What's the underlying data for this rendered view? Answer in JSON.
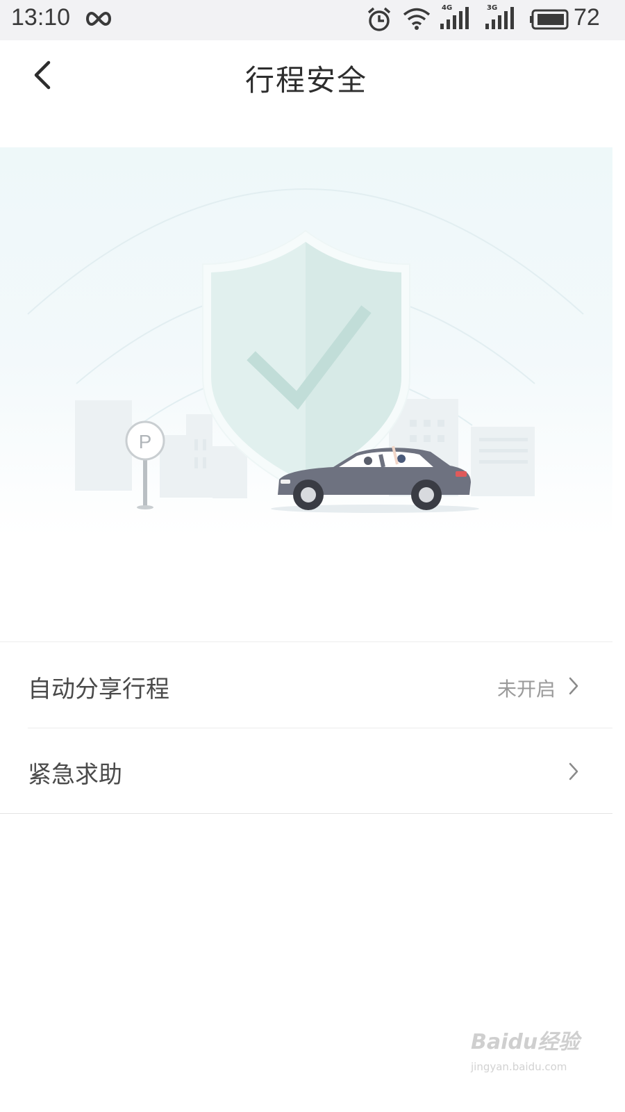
{
  "status_bar": {
    "time": "13:10",
    "battery_percent": "72",
    "network1_label": "4G",
    "network2_label": "3G",
    "icons": [
      "infinity-icon",
      "alarm-icon",
      "wifi-icon",
      "signal-4g-icon",
      "signal-3g-icon",
      "battery-icon"
    ]
  },
  "header": {
    "title": "行程安全",
    "back_icon": "chevron-left-icon"
  },
  "hero": {
    "illustration": "shield-check-car-illustration",
    "parking_sign_letter": "P"
  },
  "settings": [
    {
      "label": "自动分享行程",
      "value": "未开启",
      "icon": "chevron-right-icon"
    },
    {
      "label": "紧急求助",
      "value": "",
      "icon": "chevron-right-icon"
    }
  ],
  "watermark": {
    "text": "Baidu经验",
    "sub": "jingyan.baidu.com"
  },
  "colors": {
    "hero_bg": "#eef8f9",
    "shield": "#d9ece9",
    "check": "#c3dfda",
    "car": "#6e7280",
    "divider": "#ececec"
  }
}
